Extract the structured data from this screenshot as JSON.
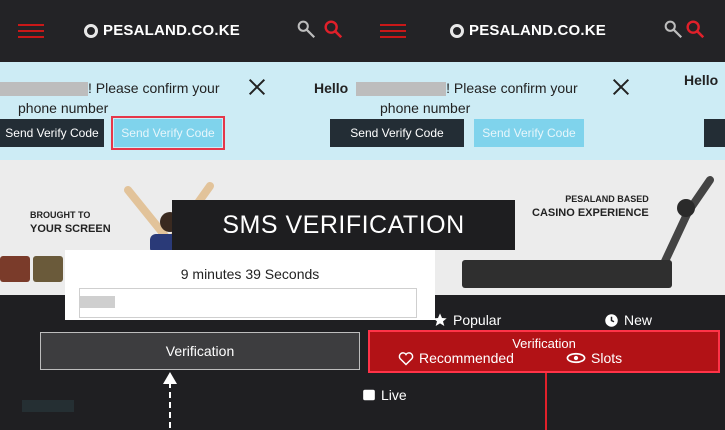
{
  "header": {
    "logo_text": "PESALAND.CO.KE",
    "logo_accent": "",
    "colors": {
      "accent": "#c91818",
      "background": "#232326"
    }
  },
  "notice": {
    "left": {
      "message": "! Please confirm your",
      "message_line2": "phone number",
      "send_button": "Send Verify Code",
      "send_button_light": "Send Verify Code"
    },
    "right": {
      "greeting": "Hello",
      "message": "! Please confirm your",
      "message_line2": "phone number",
      "send_button": "Send Verify Code",
      "send_button_light": "Send Verify Code",
      "greeting_far": "Hello"
    }
  },
  "banner": {
    "left_line1": "Brought to",
    "left_line2": "your screen",
    "right_line1": "PesaLand based",
    "right_line2": "casino experience"
  },
  "modal": {
    "title": "SMS VERIFICATION",
    "timer": "9 minutes 39 Seconds",
    "code_placeholder": ""
  },
  "categories": {
    "popular": "Popular",
    "new": "New",
    "recommended": "Recommended",
    "slots": "Slots",
    "live": "Live"
  },
  "buttons": {
    "verification_left": "Verification",
    "verification_right": "Verification"
  },
  "icons": [
    "hamburger-icon",
    "user-icon",
    "search-icon",
    "close-icon",
    "star-icon",
    "clock-icon",
    "heart-icon",
    "cards-icon",
    "live-icon"
  ]
}
